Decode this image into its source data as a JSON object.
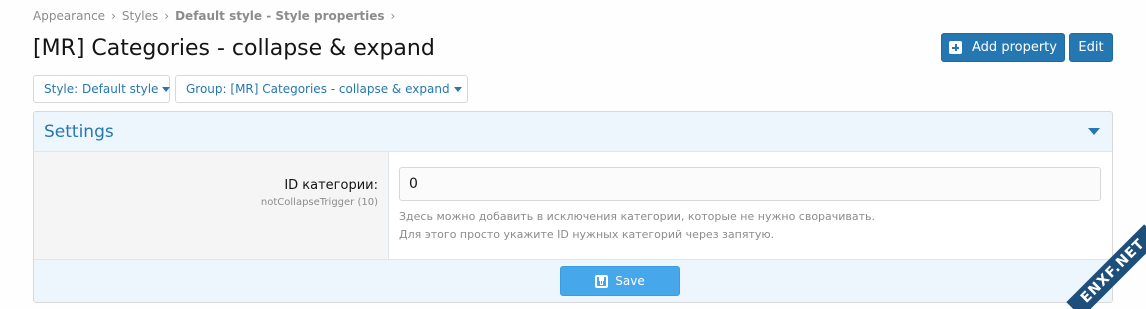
{
  "breadcrumb": {
    "items": [
      "Appearance",
      "Styles",
      "Default style - Style properties"
    ],
    "separator": "›"
  },
  "header": {
    "title": "[MR] Categories - collapse & expand",
    "add_property_label": "Add property",
    "edit_label": "Edit"
  },
  "filters": {
    "style_label": "Style: Default style",
    "group_label": "Group: [MR] Categories - collapse & expand"
  },
  "settings": {
    "title": "Settings",
    "field": {
      "label": "ID категории:",
      "hint": "notCollapseTrigger (10)",
      "value": "0",
      "explain_line1": "Здесь можно добавить в исключения категории, которые не нужно сворачивать.",
      "explain_line2": "Для этого просто укажите ID нужных категорий через запятую."
    },
    "save_label": "Save"
  },
  "watermark": "ENXF.NET",
  "colors": {
    "accent": "#2577b1",
    "save_button": "#47a7eb",
    "panel_header_bg": "#edf6fd",
    "muted_text": "#8c8c8c"
  },
  "icons": {
    "add_property": "plus-square-icon",
    "collapse": "caret-down-icon",
    "save": "floppy-disk-icon",
    "filter_dropdown": "caret-down-icon"
  }
}
